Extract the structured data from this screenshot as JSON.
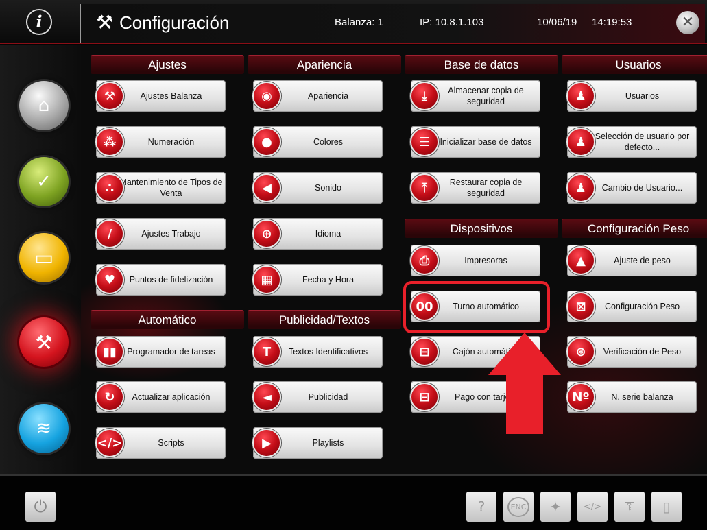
{
  "header": {
    "info_symbol": "i",
    "title_icon_glyph": "⚒",
    "title": "Configuración",
    "balanza": "Balanza: 1",
    "ip": "IP: 10.8.1.103",
    "date": "10/06/19",
    "time": "14:19:53",
    "close_symbol": "✕"
  },
  "nav": {
    "home_glyph": "⌂",
    "check_glyph": "✓",
    "monitor_glyph": "▭",
    "tools_glyph": "⚒",
    "wifi_glyph": "≋",
    "active_color": "#d4141e"
  },
  "sections": {
    "ajustes": {
      "title": "Ajustes",
      "items": [
        "Ajustes Balanza",
        "Numeración",
        "Mantenimiento de Tipos de Venta",
        "Ajustes Trabajo",
        "Puntos de fidelización"
      ]
    },
    "apariencia": {
      "title": "Apariencia",
      "items": [
        "Apariencia",
        "Colores",
        "Sonido",
        "Idioma",
        "Fecha y Hora"
      ]
    },
    "base_datos": {
      "title": "Base de datos",
      "items": [
        "Almacenar copia de seguridad",
        "Inicializar base de datos",
        "Restaurar copia de seguridad"
      ]
    },
    "usuarios": {
      "title": "Usuarios",
      "items": [
        "Usuarios",
        "Selección de usuario por defecto...",
        "Cambio de Usuario..."
      ]
    },
    "dispositivos": {
      "title": "Dispositivos",
      "items": [
        "Impresoras",
        "Turno automático",
        "Cajón automático",
        "Pago con tarjeta"
      ]
    },
    "config_peso": {
      "title": "Configuración Peso",
      "items": [
        "Ajuste de peso",
        "Configuración Peso",
        "Verificación de Peso",
        "N. serie balanza"
      ]
    },
    "automatico": {
      "title": "Automático",
      "items": [
        "Programador de tareas",
        "Actualizar aplicación",
        "Scripts"
      ]
    },
    "publicidad": {
      "title": "Publicidad/Textos",
      "items": [
        "Textos Identificativos",
        "Publicidad",
        "Playlists"
      ]
    }
  },
  "bottom": {
    "power_glyph": "⏻",
    "help_glyph": "?",
    "enc_label": "ENC",
    "wand_glyph": "✦",
    "list_glyph": "</>",
    "key_glyph": "⚿",
    "doc_glyph": "▯"
  },
  "annotation": {
    "highlight_color": "#e8202a"
  }
}
